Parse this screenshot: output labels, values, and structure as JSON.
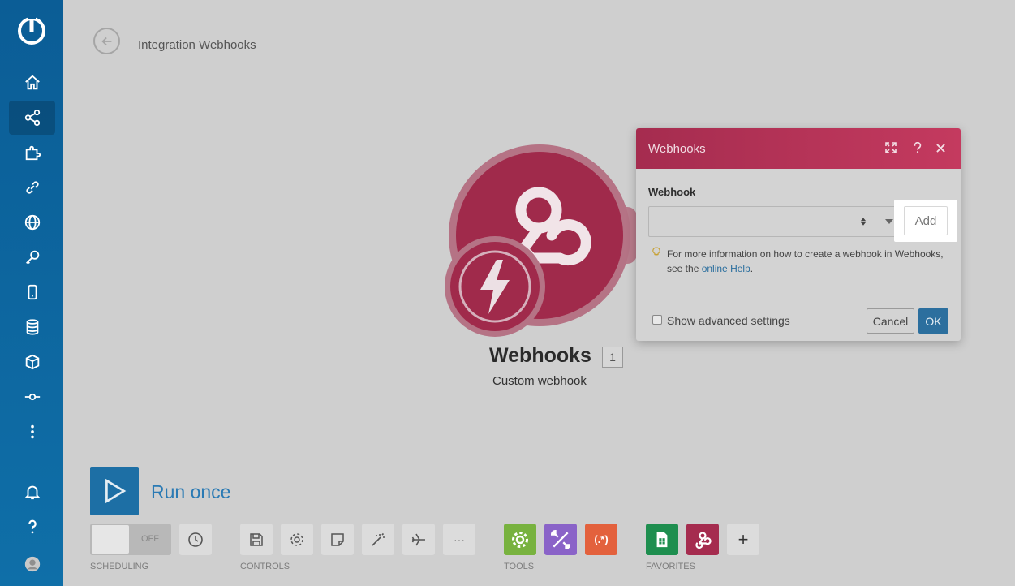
{
  "header": {
    "title": "Integration Webhooks"
  },
  "module": {
    "title": "Webhooks",
    "count": "1",
    "subtitle": "Custom webhook"
  },
  "run": {
    "label": "Run once"
  },
  "toolbar": {
    "toggle_state": "OFF",
    "scheduling_label": "SCHEDULING",
    "controls_label": "CONTROLS",
    "tools_label": "TOOLS",
    "favorites_label": "FAVORITES",
    "more_label": "···",
    "add_label": "+"
  },
  "dialog": {
    "title": "Webhooks",
    "field_label": "Webhook",
    "add_label": "Add",
    "hint_text": "For more information on how to create a webhook in Webhooks, see the ",
    "hint_link": "online Help",
    "hint_end": ".",
    "advanced_label": "Show advanced settings",
    "cancel_label": "Cancel",
    "ok_label": "OK"
  },
  "colors": {
    "sidebar": "#0f6fa8",
    "brand_webhook": "#a52c4f",
    "primary": "#2c6f9e",
    "tools_green": "#78b23f",
    "tools_purple": "#8a63c8",
    "tools_orange": "#e3613d",
    "fav_sheets": "#1e8e4f"
  }
}
